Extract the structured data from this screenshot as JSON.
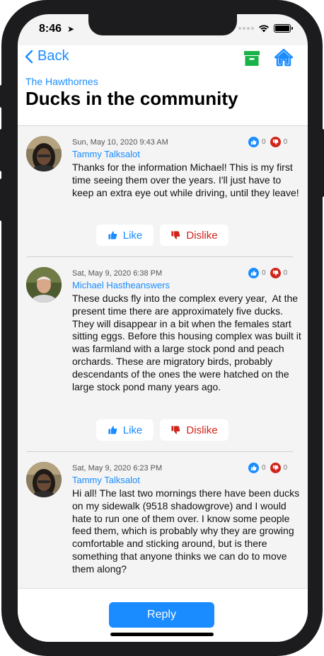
{
  "status_bar": {
    "time": "8:46",
    "location_icon": "location-arrow-icon",
    "wifi_icon": "wifi-icon",
    "battery_icon": "battery-icon"
  },
  "header": {
    "back_label": "Back",
    "community": "The Hawthornes",
    "title": "Ducks in the community",
    "archive_icon": "archive-icon",
    "home_icon": "home-icon",
    "archive_color": "#19b34a",
    "home_color": "#1a8cff"
  },
  "comments": [
    {
      "timestamp": "Sun, May 10, 2020 9:43 AM",
      "author": "Tammy Talksalot",
      "like_count": "0",
      "dislike_count": "0",
      "text": "Thanks for the information Michael! This is my first time seeing them over the years. I'll just have to keep an extra eye out while driving, until they leave!",
      "like_label": "Like",
      "dislike_label": "Dislike"
    },
    {
      "timestamp": "Sat, May 9, 2020 6:38 PM",
      "author": "Michael Hastheanswers",
      "like_count": "0",
      "dislike_count": "0",
      "text": "These ducks fly into the complex every year,  At the present time there are approximately five ducks. They will disappear in a bit when the females start sitting eggs. Before this housing complex was built it was farmland with a large stock pond and peach orchards. These are migratory birds, probably descendants of the ones the were hatched on the large stock pond many years ago.",
      "like_label": "Like",
      "dislike_label": "Dislike"
    },
    {
      "timestamp": "Sat, May 9, 2020 6:23 PM",
      "author": "Tammy Talksalot",
      "like_count": "0",
      "dislike_count": "0",
      "text": "Hi all! The last two mornings there have been ducks on my sidewalk (9518 shadowgrove) and I would hate to run one of them over. I know some people feed them, which is probably why they are growing comfortable and sticking around, but is there something that anyone thinks we can do to move them along?"
    }
  ],
  "footer": {
    "reply_label": "Reply"
  },
  "colors": {
    "accent": "#1a8cff",
    "dislike": "#d0241b",
    "background": "#f4f4f4"
  }
}
